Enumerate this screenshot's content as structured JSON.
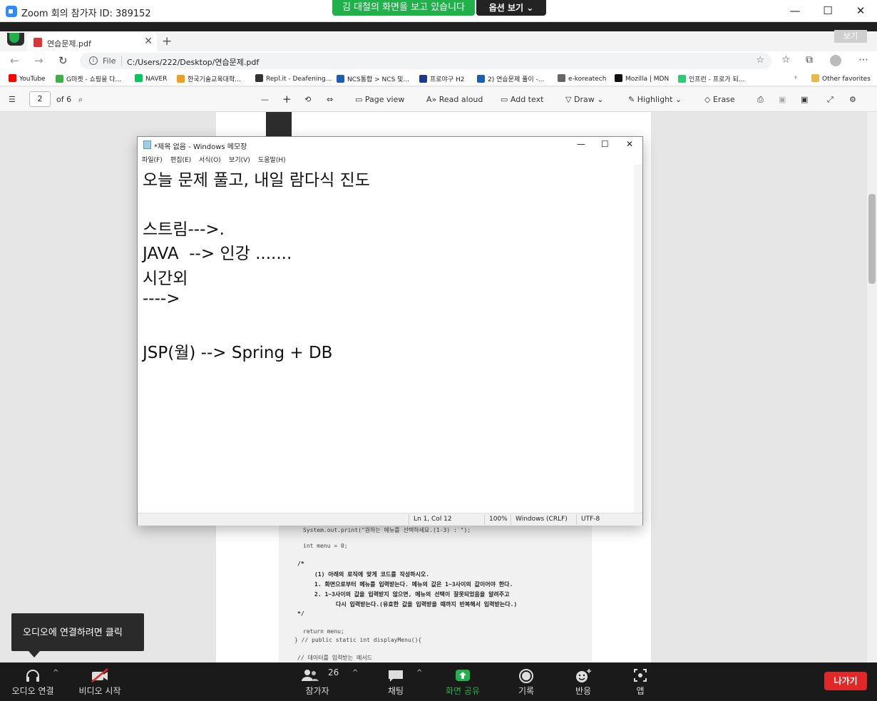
{
  "zoom": {
    "window_title": "Zoom 회의 참가자 ID: 389152",
    "share_banner": "김 대철의 화면을 보고 있습니다",
    "options_label": "옵션 보기 ⌄",
    "minimize": "—",
    "maximize": "☐",
    "close": "✕"
  },
  "browser": {
    "tab_label": "연습문제.pdf",
    "tab_close": "✕",
    "new_tab": "+",
    "viewer_badge": "보기",
    "url_scheme": "File",
    "url": "C:/Users/222/Desktop/연습문제.pdf",
    "favorites": [
      {
        "label": "YouTube",
        "color": "#ff0000"
      },
      {
        "label": "G마켓 - 쇼핑을 다...",
        "color": "#3cb043"
      },
      {
        "label": "NAVER",
        "color": "#03c75a"
      },
      {
        "label": "한국기술교육대학...",
        "color": "#f0a020"
      },
      {
        "label": "Repl.it - Deafening...",
        "color": "#333333"
      },
      {
        "label": "NCS통합 > NCS 및...",
        "color": "#1a5fb4"
      },
      {
        "label": "프로야구 H2",
        "color": "#1e3a8a"
      },
      {
        "label": "2) 연습문제 풀이 -...",
        "color": "#1a5fb4"
      },
      {
        "label": "e-koreatech",
        "color": "#666666"
      },
      {
        "label": "Mozilla | MDN",
        "color": "#111111"
      },
      {
        "label": "인프런 - 프로가 되...",
        "color": "#2ecc71"
      }
    ],
    "other_favorites": "Other favorites"
  },
  "pdf_toolbar": {
    "page_current": "2",
    "page_total": "of 6",
    "page_view": "Page view",
    "read_aloud": "Read aloud",
    "add_text": "Add text",
    "draw": "Draw",
    "highlight": "Highlight",
    "erase": "Erase"
  },
  "pdf_code": [
    "System.out.print(\"원하는 메뉴를 선택하세요.(1-3) : \");",
    "int menu = 0;",
    "/*",
    "(1) 아래의 로직에 맞게 코드를 작성하시오.",
    "1. 화면으로부터 메뉴를 입력받는다. 메뉴의 값은 1~3사이의 값이어야 한다.",
    "2. 1~3사이의 값을 입력받지 않으면, 메뉴의 선택이 잘못되었음을 알려주고",
    "다시 입력받는다.(유효한 값을 입력받을 때까지 반복해서 입력받는다.)",
    "*/",
    "return menu;",
    "} // public static int displayMenu(){",
    "// 데이터를 입력받는 메서드"
  ],
  "notepad": {
    "title": "*제목 없음 - Windows 메모장",
    "menu": [
      "파일(F)",
      "편집(E)",
      "서식(O)",
      "보기(V)",
      "도움말(H)"
    ],
    "lines": [
      "오늘 문제 풀고, 내일 람다식 진도",
      "",
      "스트림--->.",
      "JAVA  --> 인강 .......",
      "시간외",
      "---->",
      "",
      "JSP(월) --> Spring + DB"
    ],
    "status": {
      "position": "Ln 1, Col 12",
      "zoom": "100%",
      "line_ending": "Windows (CRLF)",
      "encoding": "UTF-8"
    }
  },
  "tooltip": "오디오에 연결하려면 클릭",
  "controls": {
    "audio": "오디오 연결",
    "video": "비디오 시작",
    "participants": "참가자",
    "participants_count": "26",
    "chat": "채팅",
    "share": "화면 공유",
    "record": "기록",
    "reactions": "반응",
    "apps": "앱",
    "leave": "나가기"
  }
}
